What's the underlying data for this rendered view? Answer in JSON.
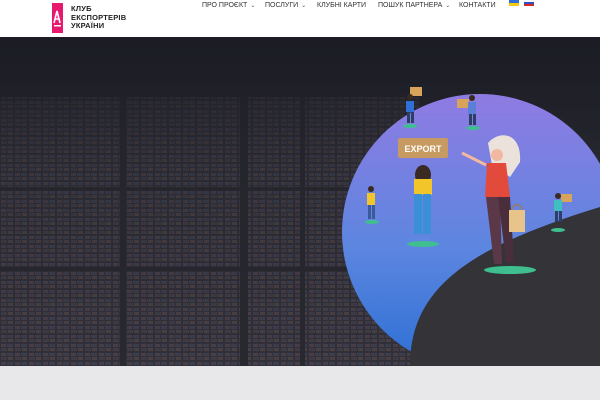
{
  "brand": {
    "name_line1": "КЛУБ",
    "name_line2": "ЕКСПОРТЕРІВ",
    "name_line3": "УКРАЇНИ",
    "accent_color": "#e6196e"
  },
  "nav": {
    "items": [
      {
        "label": "ПРО ПРОЄКТ",
        "has_dropdown": true
      },
      {
        "label": "ПОСЛУГИ",
        "has_dropdown": true
      },
      {
        "label": "КЛУБНІ КАРТИ",
        "has_dropdown": false
      },
      {
        "label": "ПОШУК ПАРТНЕРА",
        "has_dropdown": true
      },
      {
        "label": "КОНТАКТИ",
        "has_dropdown": false
      }
    ],
    "languages": [
      {
        "code": "uk",
        "icon": "ukraine-flag-icon"
      },
      {
        "code": "ru",
        "icon": "russia-flag-icon"
      }
    ]
  },
  "hero": {
    "sign_text": "EXPORT",
    "gradient_top": "#8a78e0",
    "gradient_bottom": "#2a6fd6"
  }
}
